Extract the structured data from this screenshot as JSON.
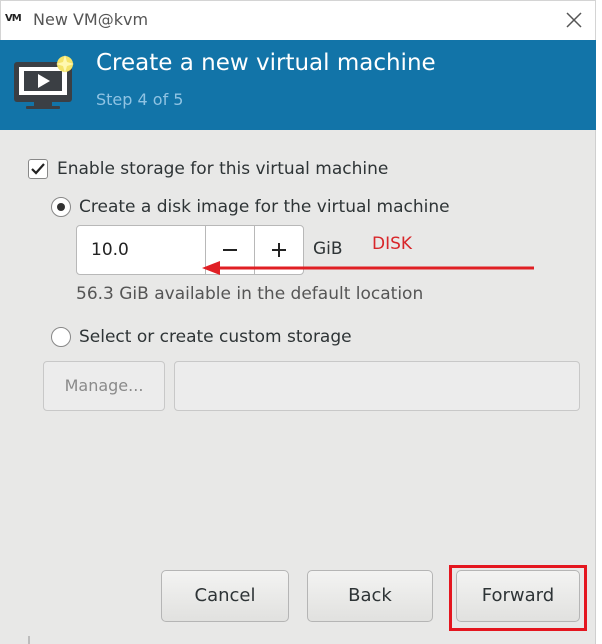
{
  "window": {
    "app_icon_text": "VM",
    "title": "New VM@kvm",
    "close_icon": "close-icon"
  },
  "header": {
    "title": "Create a new virtual machine",
    "step": "Step 4 of 5",
    "icon": "monitor-play-icon",
    "colors": {
      "background": "#1274a8",
      "title": "#ffffff",
      "step": "#8fc3e3"
    }
  },
  "storage": {
    "enable_label": "Enable storage for this virtual machine",
    "enable_checked": true,
    "disk_image_label": "Create a disk image for the virtual machine",
    "disk_image_selected": true,
    "size_value": "10.0",
    "size_unit": "GiB",
    "available_text": "56.3 GiB available in the default location",
    "custom_label": "Select or create custom storage",
    "custom_selected": false,
    "manage_label": "Manage...",
    "path_value": ""
  },
  "annotation": {
    "label": "DISK",
    "color": "#d8262a"
  },
  "buttons": {
    "cancel": "Cancel",
    "back": "Back",
    "forward": "Forward",
    "highlight_color": "#e4161f"
  }
}
